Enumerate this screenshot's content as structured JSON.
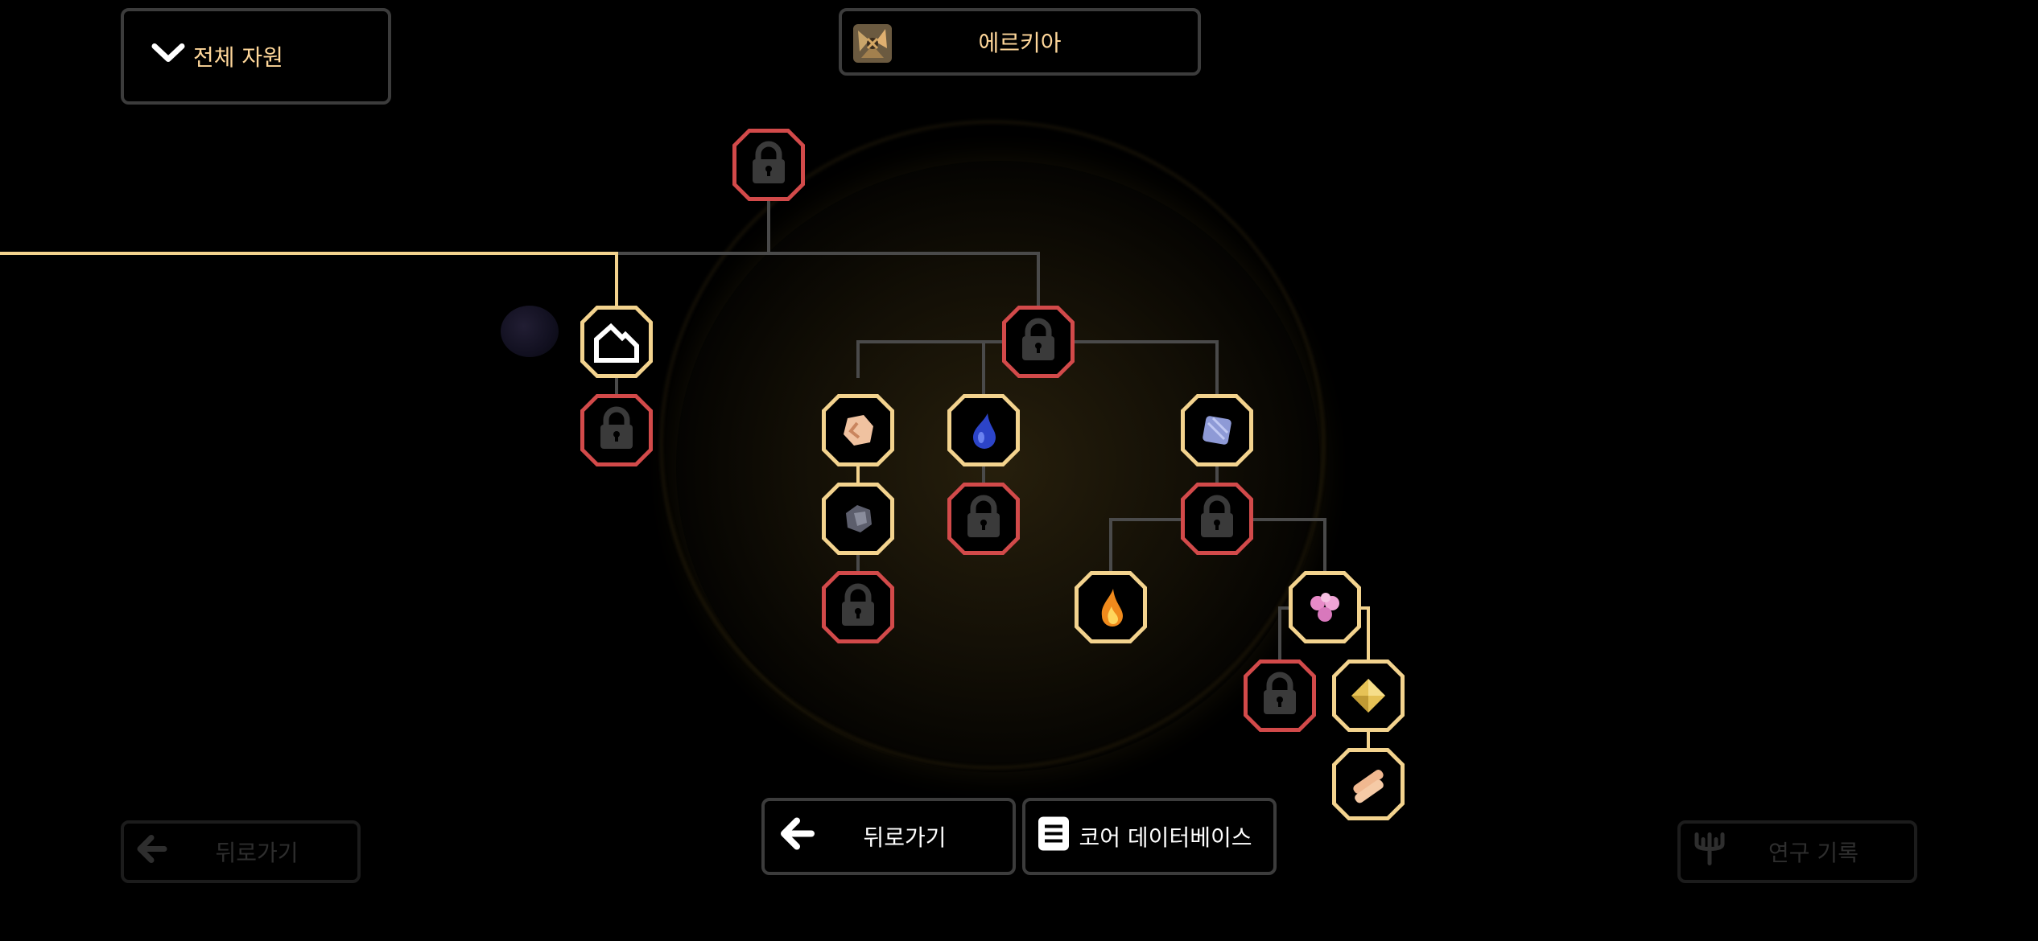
{
  "top": {
    "filter_label": "전체 자원",
    "planet_name": "에르키아"
  },
  "bottom": {
    "back_label": "뒤로가기",
    "database_label": "코어 데이터베이스",
    "back_ghost_label": "뒤로가기",
    "research_log_label": "연구 기록"
  },
  "colors": {
    "accent": "#f3d38e",
    "locked": "#d24a4a",
    "line_active": "#f3d38e",
    "line_inactive": "#4a4a4a",
    "button_border": "#3c3c3c"
  },
  "nodes": [
    {
      "id": "root",
      "state": "locked",
      "icon": "lock-icon"
    },
    {
      "id": "home",
      "state": "open",
      "icon": "home-base-icon"
    },
    {
      "id": "home-child",
      "state": "locked",
      "icon": "lock-icon"
    },
    {
      "id": "hub",
      "state": "locked",
      "icon": "lock-icon"
    },
    {
      "id": "copper",
      "state": "open",
      "icon": "copper-ore-icon"
    },
    {
      "id": "stone",
      "state": "open",
      "icon": "stone-ore-icon"
    },
    {
      "id": "stone-child",
      "state": "locked",
      "icon": "lock-icon"
    },
    {
      "id": "blue-drop",
      "state": "open",
      "icon": "blue-liquid-icon"
    },
    {
      "id": "blue-drop-child",
      "state": "locked",
      "icon": "lock-icon"
    },
    {
      "id": "crystal",
      "state": "open",
      "icon": "blue-crystal-icon"
    },
    {
      "id": "crystal-child",
      "state": "locked",
      "icon": "lock-icon"
    },
    {
      "id": "flame",
      "state": "open",
      "icon": "flame-drop-icon"
    },
    {
      "id": "pink",
      "state": "open",
      "icon": "pink-cluster-icon"
    },
    {
      "id": "pink-child",
      "state": "locked",
      "icon": "lock-icon"
    },
    {
      "id": "gold",
      "state": "open",
      "icon": "gold-ingot-icon"
    },
    {
      "id": "bars",
      "state": "open",
      "icon": "copper-bars-icon"
    }
  ]
}
